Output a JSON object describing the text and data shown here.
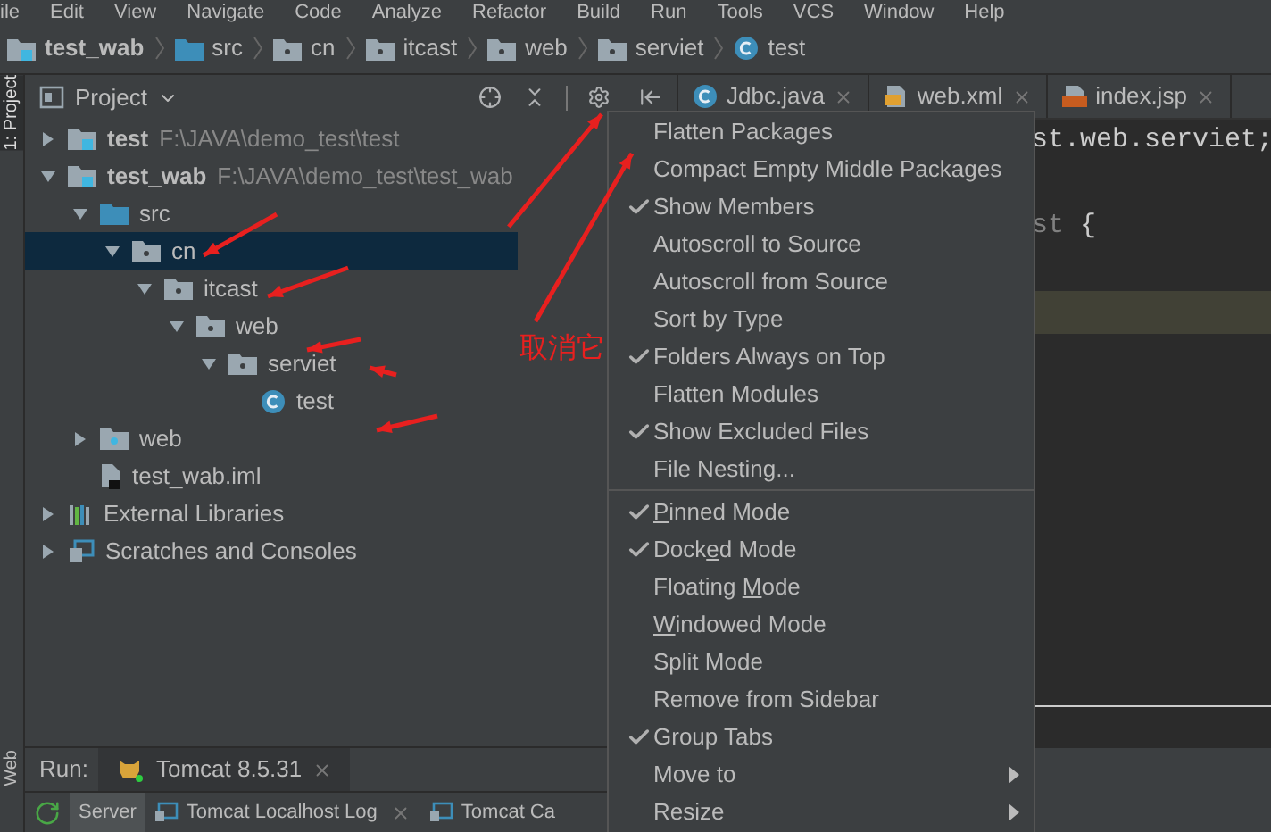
{
  "menu_bar": [
    "ile",
    "Edit",
    "View",
    "Navigate",
    "Code",
    "Analyze",
    "Refactor",
    "Build",
    "Run",
    "Tools",
    "VCS",
    "Window",
    "Help"
  ],
  "breadcrumbs": [
    {
      "label": "test_wab",
      "kind": "module"
    },
    {
      "label": "src",
      "kind": "source"
    },
    {
      "label": "cn",
      "kind": "package"
    },
    {
      "label": "itcast",
      "kind": "package"
    },
    {
      "label": "web",
      "kind": "package"
    },
    {
      "label": "serviet",
      "kind": "package"
    },
    {
      "label": "test",
      "kind": "class"
    }
  ],
  "side_tabs": [
    {
      "label": "1: Project",
      "selected": true
    },
    {
      "label": "Web",
      "selected": false
    }
  ],
  "project_panel": {
    "title": "Project",
    "tree": [
      {
        "label": "test",
        "path": "F:\\JAVA\\demo_test\\test",
        "kind": "module",
        "expanded": false,
        "selected": false
      },
      {
        "label": "test_wab",
        "path": "F:\\JAVA\\demo_test\\test_wab",
        "kind": "module",
        "expanded": true,
        "selected": false,
        "children": [
          {
            "label": "src",
            "kind": "source",
            "expanded": true,
            "selected": false,
            "children": [
              {
                "label": "cn",
                "kind": "package",
                "expanded": true,
                "selected": true,
                "children": [
                  {
                    "label": "itcast",
                    "kind": "package",
                    "expanded": true,
                    "selected": false,
                    "children": [
                      {
                        "label": "web",
                        "kind": "package",
                        "expanded": true,
                        "selected": false,
                        "children": [
                          {
                            "label": "serviet",
                            "kind": "package",
                            "expanded": true,
                            "selected": false,
                            "children": [
                              {
                                "label": "test",
                                "kind": "class",
                                "selected": false
                              }
                            ]
                          }
                        ]
                      }
                    ]
                  }
                ]
              }
            ]
          },
          {
            "label": "web",
            "kind": "webfolder",
            "expanded": false,
            "selected": false
          },
          {
            "label": "test_wab.iml",
            "kind": "file",
            "selected": false
          }
        ]
      },
      {
        "label": "External Libraries",
        "kind": "libraries",
        "expanded": false,
        "selected": false
      },
      {
        "label": "Scratches and Consoles",
        "kind": "scratches",
        "expanded": false,
        "selected": false
      }
    ]
  },
  "editor": {
    "tabs": [
      {
        "label": "Jdbc.java",
        "kind": "java"
      },
      {
        "label": "web.xml",
        "kind": "xml"
      },
      {
        "label": "index.jsp",
        "kind": "jsp"
      }
    ],
    "lines": [
      {
        "kind": "code",
        "segments": [
          {
            "text": "st.web.serviet;",
            "kind": "plain"
          }
        ]
      },
      {
        "kind": "blank"
      },
      {
        "kind": "code",
        "segments": [
          {
            "text": "st",
            "kind": "unused"
          },
          {
            "text": " {",
            "kind": "plain"
          }
        ]
      },
      {
        "kind": "blank"
      },
      {
        "kind": "caret_line"
      }
    ]
  },
  "popup_menu": [
    [
      {
        "label": "Flatten Packages",
        "checked": false
      },
      {
        "label": "Compact Empty Middle Packages",
        "checked": false
      },
      {
        "label": "Show Members",
        "checked": true
      },
      {
        "label": "Autoscroll to Source",
        "checked": false
      },
      {
        "label": "Autoscroll from Source",
        "checked": false
      },
      {
        "label": "Sort by Type",
        "checked": false
      },
      {
        "label": "Folders Always on Top",
        "checked": true
      },
      {
        "label": "Flatten Modules",
        "checked": false
      },
      {
        "label": "Show Excluded Files",
        "checked": true
      },
      {
        "label": "File Nesting...",
        "checked": false
      }
    ],
    [
      {
        "label_parts": [
          {
            "text": "P",
            "underlined": true
          },
          {
            "text": "inned Mode",
            "underlined": false
          }
        ],
        "checked": true
      },
      {
        "label_parts": [
          {
            "text": "Dock",
            "underlined": false
          },
          {
            "text": "e",
            "underlined": true
          },
          {
            "text": "d Mode",
            "underlined": false
          }
        ],
        "checked": true
      },
      {
        "label_parts": [
          {
            "text": "Floating ",
            "underlined": false
          },
          {
            "text": "M",
            "underlined": true
          },
          {
            "text": "ode",
            "underlined": false
          }
        ],
        "checked": false
      },
      {
        "label_parts": [
          {
            "text": "W",
            "underlined": true
          },
          {
            "text": "indowed Mode",
            "underlined": false
          }
        ],
        "checked": false
      },
      {
        "label": "Split Mode",
        "checked": false
      },
      {
        "label": "Remove from Sidebar",
        "checked": false
      },
      {
        "label": "Group Tabs",
        "checked": true
      },
      {
        "label": "Move to",
        "checked": false,
        "submenu": true
      },
      {
        "label": "Resize",
        "checked": false,
        "submenu": true
      }
    ]
  ],
  "annotation": "取消它",
  "run_bar": {
    "label": "Run:",
    "tab": "Tomcat 8.5.31"
  },
  "run_tabs": [
    {
      "label": "Server",
      "selected": true,
      "closable": false
    },
    {
      "label": "Tomcat Localhost Log",
      "selected": false,
      "closable": true
    },
    {
      "label": "Tomcat Ca",
      "selected": false,
      "closable": false
    }
  ]
}
